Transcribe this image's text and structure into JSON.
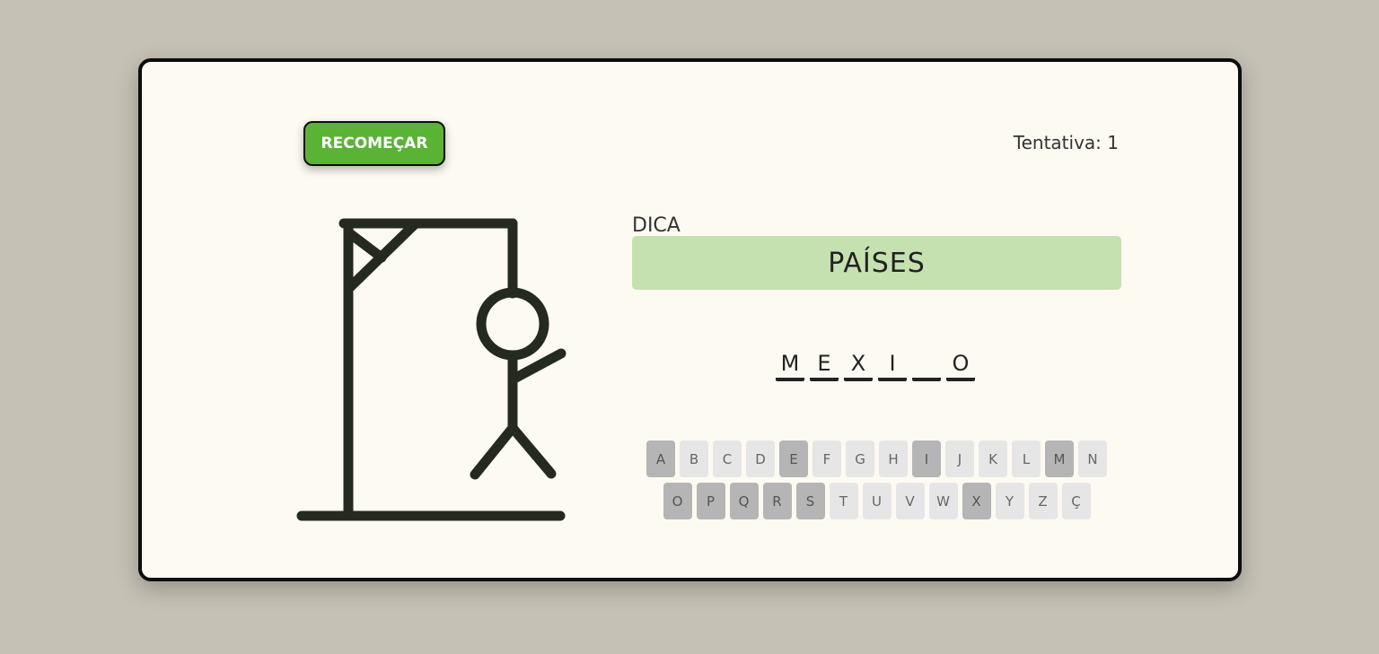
{
  "game": {
    "restart_label": "RECOMEÇAR",
    "attempt_text": "Tentativa: 1",
    "hint_label": "DICA",
    "hint_value": "PAÍSES",
    "word_slots": [
      "M",
      "E",
      "X",
      "I",
      "",
      "O"
    ],
    "keyboard_rows": [
      [
        {
          "letter": "A",
          "used": true
        },
        {
          "letter": "B",
          "used": false
        },
        {
          "letter": "C",
          "used": false
        },
        {
          "letter": "D",
          "used": false
        },
        {
          "letter": "E",
          "used": true
        },
        {
          "letter": "F",
          "used": false
        },
        {
          "letter": "G",
          "used": false
        },
        {
          "letter": "H",
          "used": false
        },
        {
          "letter": "I",
          "used": true
        },
        {
          "letter": "J",
          "used": false
        },
        {
          "letter": "K",
          "used": false
        },
        {
          "letter": "L",
          "used": false
        },
        {
          "letter": "M",
          "used": true
        },
        {
          "letter": "N",
          "used": false
        }
      ],
      [
        {
          "letter": "O",
          "used": true
        },
        {
          "letter": "P",
          "used": true
        },
        {
          "letter": "Q",
          "used": true
        },
        {
          "letter": "R",
          "used": true
        },
        {
          "letter": "S",
          "used": true
        },
        {
          "letter": "T",
          "used": false
        },
        {
          "letter": "U",
          "used": false
        },
        {
          "letter": "V",
          "used": false
        },
        {
          "letter": "W",
          "used": false
        },
        {
          "letter": "X",
          "used": true
        },
        {
          "letter": "Y",
          "used": false
        },
        {
          "letter": "Z",
          "used": false
        },
        {
          "letter": "Ç",
          "used": false
        }
      ]
    ],
    "hangman_parts": [
      "head",
      "body",
      "right-arm",
      "left-leg",
      "right-leg"
    ]
  },
  "colors": {
    "background": "#c5c1b5",
    "card": "#fdfaf2",
    "restart_button": "#5bb336",
    "hint_box": "#c6e1b0",
    "key_default": "#e6e6e6",
    "key_used": "#b5b5b5",
    "drawing": "#252a20"
  }
}
